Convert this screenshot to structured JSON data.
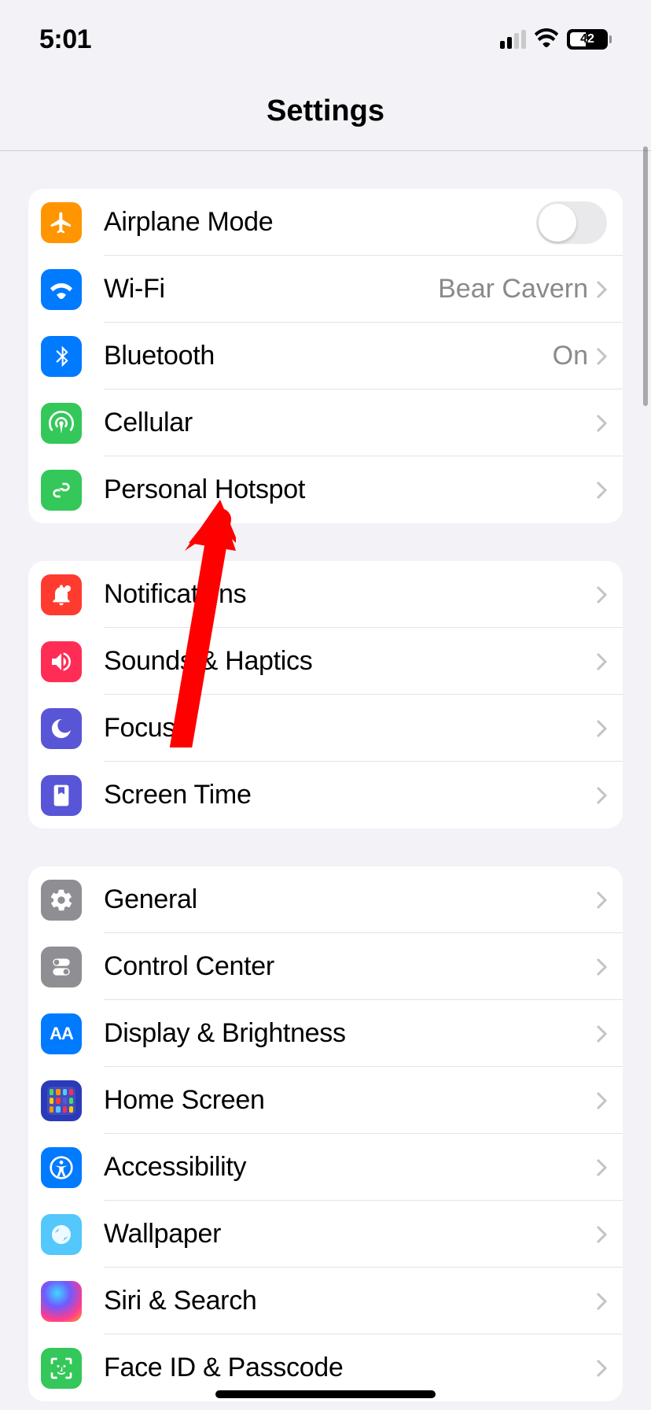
{
  "status": {
    "time": "5:01",
    "battery": "42"
  },
  "header": {
    "title": "Settings"
  },
  "sections": [
    {
      "rows": [
        {
          "icon": "airplane",
          "color": "orange",
          "label": "Airplane Mode",
          "control": "toggle"
        },
        {
          "icon": "wifi",
          "color": "blue",
          "label": "Wi-Fi",
          "value": "Bear Cavern",
          "control": "chevron"
        },
        {
          "icon": "bluetooth",
          "color": "blue",
          "label": "Bluetooth",
          "value": "On",
          "control": "chevron"
        },
        {
          "icon": "cellular",
          "color": "green",
          "label": "Cellular",
          "control": "chevron"
        },
        {
          "icon": "hotspot",
          "color": "green",
          "label": "Personal Hotspot",
          "control": "chevron"
        }
      ]
    },
    {
      "rows": [
        {
          "icon": "notifications",
          "color": "red",
          "label": "Notifications",
          "control": "chevron"
        },
        {
          "icon": "sounds",
          "color": "pink",
          "label": "Sounds & Haptics",
          "control": "chevron"
        },
        {
          "icon": "focus",
          "color": "indigo",
          "label": "Focus",
          "control": "chevron"
        },
        {
          "icon": "screentime",
          "color": "indigo",
          "label": "Screen Time",
          "control": "chevron"
        }
      ]
    },
    {
      "rows": [
        {
          "icon": "general",
          "color": "gray",
          "label": "General",
          "control": "chevron"
        },
        {
          "icon": "controlcenter",
          "color": "gray",
          "label": "Control Center",
          "control": "chevron"
        },
        {
          "icon": "display",
          "color": "blue",
          "label": "Display & Brightness",
          "control": "chevron"
        },
        {
          "icon": "homescreen",
          "color": "homescreen",
          "label": "Home Screen",
          "control": "chevron"
        },
        {
          "icon": "accessibility",
          "color": "blue",
          "label": "Accessibility",
          "control": "chevron"
        },
        {
          "icon": "wallpaper",
          "color": "lightblue",
          "label": "Wallpaper",
          "control": "chevron"
        },
        {
          "icon": "siri",
          "color": "siri",
          "label": "Siri & Search",
          "control": "chevron"
        },
        {
          "icon": "faceid",
          "color": "green",
          "label": "Face ID & Passcode",
          "control": "chevron"
        }
      ]
    }
  ]
}
